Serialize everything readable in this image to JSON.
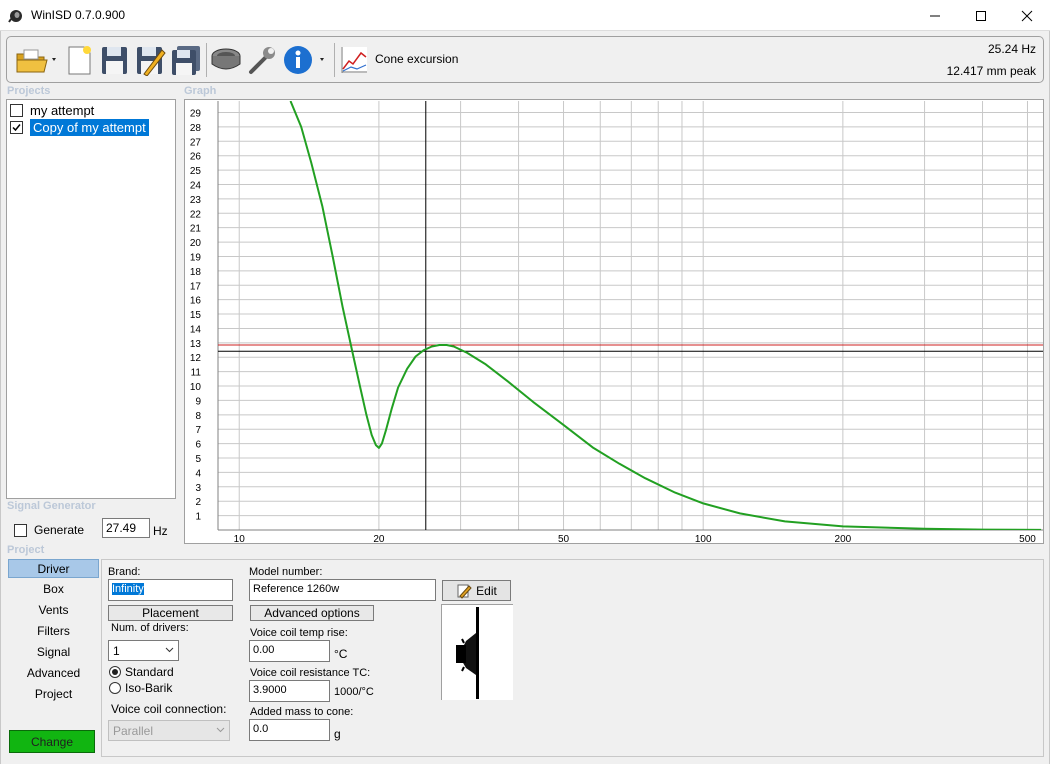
{
  "window": {
    "title": "WinISD 0.7.0.900"
  },
  "toolbar": {
    "icons": [
      "open-folder-icon",
      "new-project-icon",
      "save-icon",
      "save-edit-icon",
      "save-all-icon",
      "driver-icon",
      "tools-icon",
      "info-icon",
      "cone-excursion-icon"
    ],
    "cone_excursion_label": "Cone excursion",
    "readout_freq": "25.24 Hz",
    "readout_peak": "12.417 mm peak"
  },
  "sections": {
    "projects": "Projects",
    "graph": "Graph",
    "signal_generator": "Signal Generator",
    "project": "Project"
  },
  "projects": [
    {
      "name": "my attempt",
      "checked": false,
      "selected": false
    },
    {
      "name": "Copy of my attempt",
      "checked": true,
      "selected": true
    }
  ],
  "signal_generator": {
    "generate_label": "Generate",
    "value": "27.49",
    "unit": "Hz"
  },
  "chart_data": {
    "type": "line",
    "x_scale": "log",
    "xlim": [
      9,
      540
    ],
    "ylim": [
      0,
      29.8
    ],
    "x_ticks": [
      10,
      20,
      50,
      100,
      200,
      500
    ],
    "y_ticks": [
      1,
      2,
      3,
      4,
      5,
      6,
      7,
      8,
      9,
      10,
      11,
      12,
      13,
      14,
      15,
      16,
      17,
      18,
      19,
      20,
      21,
      22,
      23,
      24,
      25,
      26,
      27,
      28,
      29
    ],
    "grid": true,
    "cursor": {
      "x": 25.24,
      "y": 12.417
    },
    "limit_line": 12.85,
    "series": [
      {
        "color": "#22a022",
        "x": [
          12.9,
          13.6,
          14.3,
          15.1,
          15.9,
          16.7,
          17.5,
          18.2,
          18.8,
          19.3,
          19.7,
          20.0,
          20.3,
          20.7,
          21.3,
          22.0,
          23.0,
          24.0,
          25.0,
          26.0,
          27.0,
          28.0,
          29.0,
          31.0,
          34.0,
          38.0,
          43.0,
          50.0,
          58.0,
          66.0,
          75.0,
          87.0,
          100.0,
          120.0,
          150.0,
          200.0,
          300.0,
          400.0,
          535.0
        ],
        "values": [
          29.8,
          28.0,
          25.5,
          22.5,
          19.0,
          15.5,
          12.5,
          10.0,
          8.0,
          6.6,
          5.9,
          5.7,
          6.0,
          6.9,
          8.4,
          9.9,
          11.2,
          12.05,
          12.5,
          12.75,
          12.85,
          12.85,
          12.75,
          12.3,
          11.5,
          10.3,
          8.9,
          7.3,
          5.7,
          4.6,
          3.6,
          2.6,
          1.85,
          1.15,
          0.6,
          0.25,
          0.08,
          0.03,
          0.01
        ]
      }
    ]
  },
  "project_tabs": [
    "Driver",
    "Box",
    "Vents",
    "Filters",
    "Signal",
    "Advanced",
    "Project"
  ],
  "change_button": "Change",
  "driver": {
    "brand_label": "Brand:",
    "brand_value": "Infinity",
    "model_label": "Model number:",
    "model_value": "Reference 1260w",
    "edit_button": "Edit",
    "placement_button": "Placement",
    "advanced_button": "Advanced options",
    "num_drivers_label": "Num. of drivers:",
    "num_drivers_value": "1",
    "radio_standard": "Standard",
    "radio_isobarik": "Iso-Barik",
    "voice_coil_conn_label": "Voice coil connection:",
    "voice_coil_conn_value": "Parallel",
    "vc_temp_label": "Voice coil temp rise:",
    "vc_temp_value": "0.00",
    "vc_temp_unit": "°C",
    "vc_res_label": "Voice coil resistance TC:",
    "vc_res_value": "3.9000",
    "vc_res_unit": "1000/°C",
    "added_mass_label": "Added mass to cone:",
    "added_mass_value": "0.0",
    "added_mass_unit": "g"
  }
}
